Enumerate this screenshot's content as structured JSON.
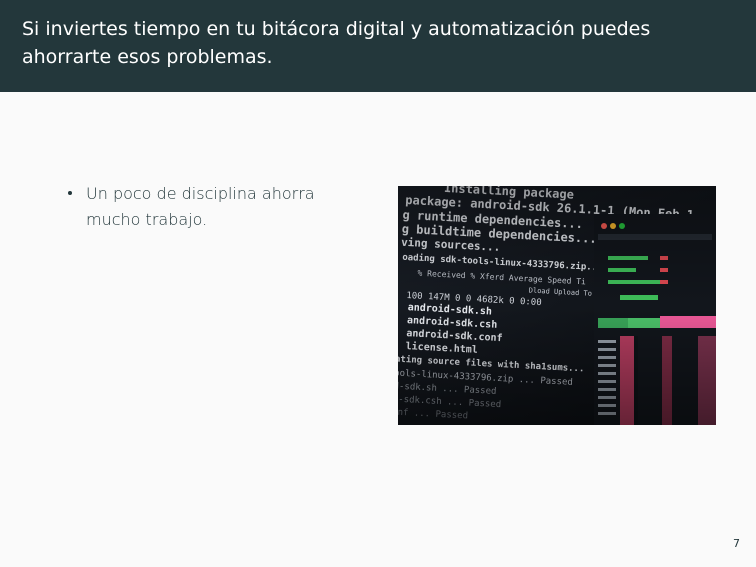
{
  "slide": {
    "title": "Si inviertes tiempo en tu bitácora digital y automatización puedes ahorrarte esos problemas.",
    "bullets": [
      {
        "text": "Un poco de disciplina ahorra mucho trabajo."
      }
    ],
    "page_number": "7"
  },
  "colors": {
    "header_bg": "#23373b",
    "header_text": "#ffffff",
    "body_bg": "#fafafa",
    "body_text": "#23373b"
  },
  "image": {
    "kind": "photo-terminal-screen",
    "terminal_lines": [
      "Installing package",
      "package: android-sdk 26.1.1-1 (Mon Feb 1",
      "g runtime dependencies...",
      "g buildtime dependencies...",
      "ving sources...",
      "oading sdk-tools-linux-4333796.zip...",
      "% Received % Xferd  Average Speed  Ti",
      "Dload  Upload  To",
      "100  147M   0   0  4682k   0 0:00",
      "android-sdk.sh",
      "android-sdk.csh",
      "android-sdk.conf",
      "license.html",
      "ating source files with sha1sums...",
      "ools-linux-4333796.zip ... Passed",
      "d-sdk.sh ... Passed",
      "d-sdk.csh ... Passed",
      "onf ... Passed"
    ]
  }
}
